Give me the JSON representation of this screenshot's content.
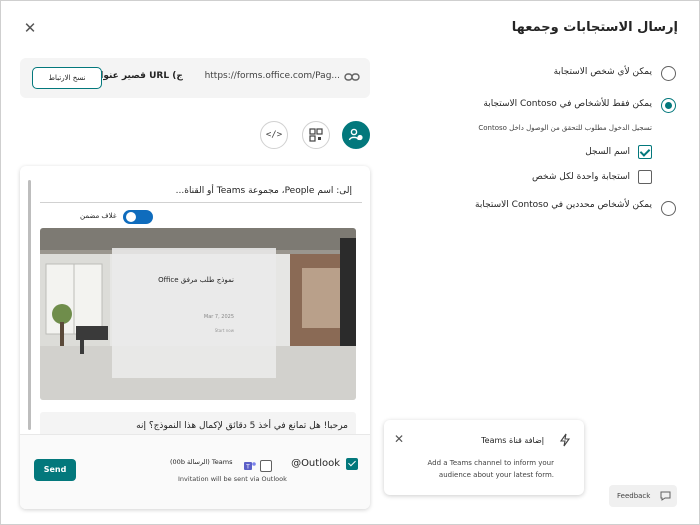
{
  "dialog": {
    "title": "إرسال الاستجابات وجمعها"
  },
  "responders": {
    "option_anyone": "يمكن لأي شخص الاستجابة",
    "option_org": "يمكن فقط للأشخاص في Contoso الاستجابة",
    "org_hint": "تسجيل الدخول مطلوب للتحقق من الوصول داخل Contoso",
    "record_name": "اسم السجل",
    "one_response": "استجابة واحدة لكل شخص",
    "option_specific": "يمكن لأشخاص محددين في Contoso الاستجابة"
  },
  "link": {
    "url": "https://forms.office.com/Pag...",
    "shorten": "قصير عنوان URL (ج",
    "copy_label": "نسخ الارتباط"
  },
  "email": {
    "to_line": "إلى: اسم People، مجموعة Teams أو القناة...",
    "toggle_label": "غلاف مضمن",
    "card_title": "نموذج طلب مرفق Office",
    "card_date": "Mar 7, 2025",
    "card_sub": "Start now",
    "message": "مرحبا! هل تمانع في أخذ 5 دقائق لإكمال هذا النموذج؟ إنه",
    "outlook_label": "@Outlook",
    "teams_label": "Teams (الرسالة 00b)",
    "via_text": "Invitation will be sent via Outlook",
    "send_label": "Send"
  },
  "teams_popup": {
    "title": "إضافة قناة Teams",
    "line1": "Add a Teams channel to inform your",
    "line2": "audience about your latest form."
  },
  "feedback_label": "Feedback",
  "colors": {
    "accent": "#03787c",
    "toggle": "#0f6cbd"
  }
}
